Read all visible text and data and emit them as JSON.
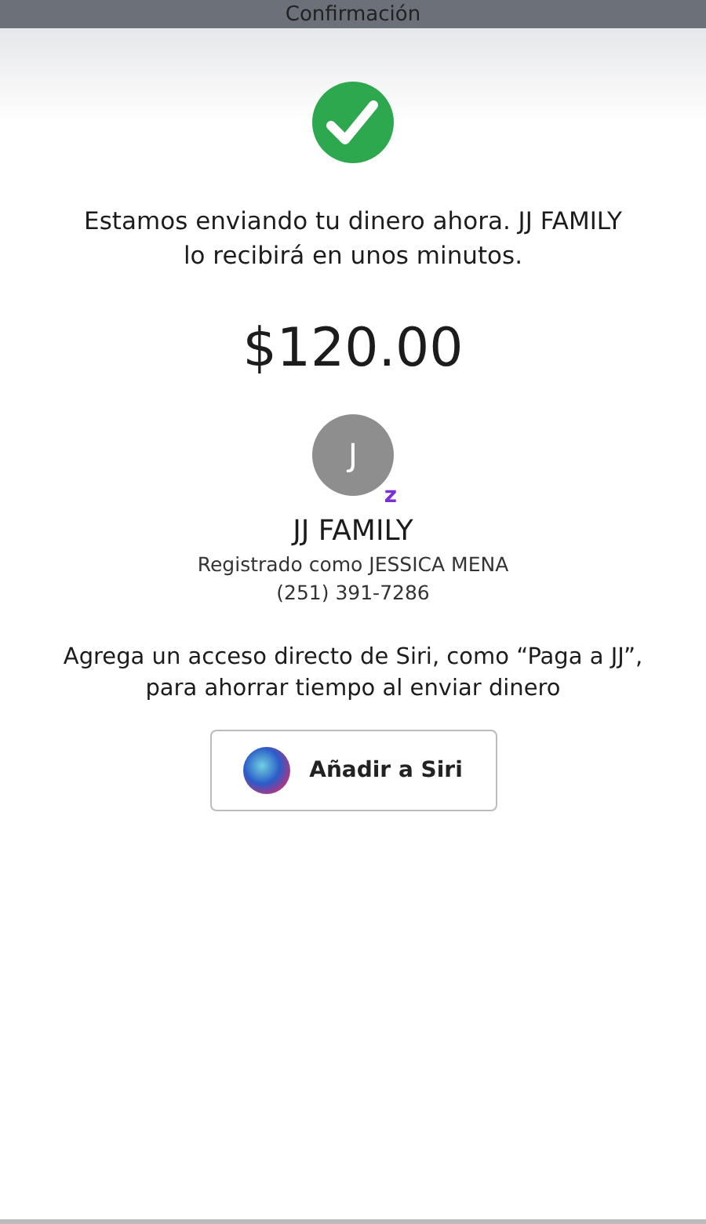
{
  "header": {
    "title": "Confirmación"
  },
  "message": "Estamos enviando tu dinero ahora. JJ FAMILY lo recibirá en unos minutos.",
  "amount": "$120.00",
  "recipient": {
    "initial": "J",
    "badge": "z",
    "name": "JJ FAMILY",
    "registered": "Registrado como JESSICA MENA",
    "phone": "(251) 391-7286"
  },
  "siri_hint": "Agrega un acceso directo de Siri, como “Paga a JJ”, para ahorrar tiempo al enviar dinero",
  "siri_button": "Añadir a Siri"
}
